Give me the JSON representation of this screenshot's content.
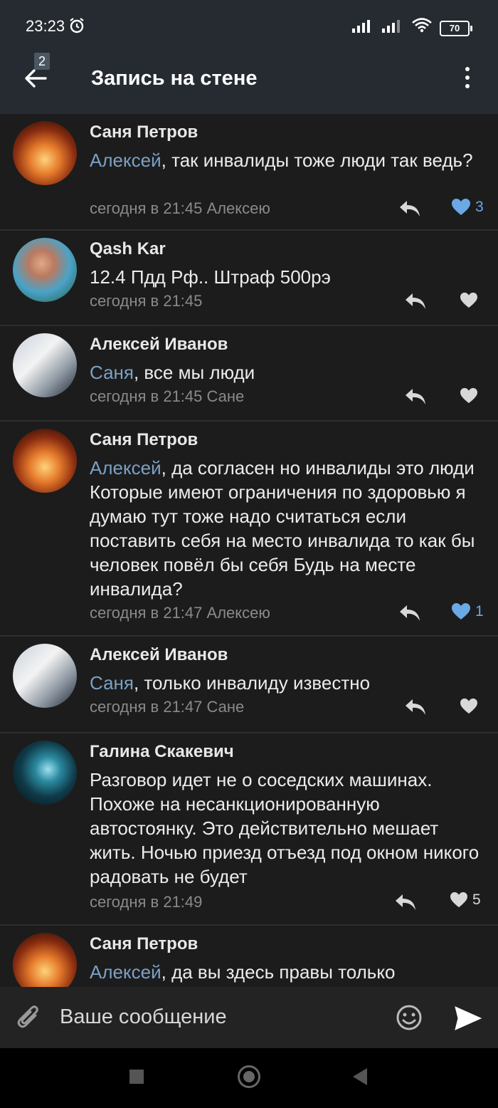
{
  "status": {
    "time": "23:23",
    "battery": "70"
  },
  "appbar": {
    "title": "Запись на стене",
    "badge": "2"
  },
  "comments": [
    {
      "author": "Саня Петров",
      "reply_to": "Алексей",
      "text": ", так инвалиды тоже люди так ведь?",
      "time": "сегодня в 21:45",
      "meta_to": " Алексею",
      "likes": "3"
    },
    {
      "author": "Qash Kar",
      "reply_to": "",
      "text": "12.4 Пдд Рф.. Штраф 500рэ",
      "time": "сегодня в 21:45",
      "meta_to": "",
      "likes": ""
    },
    {
      "author": "Алексей Иванов",
      "reply_to": "Саня",
      "text": ", все мы люди",
      "time": "сегодня в 21:45",
      "meta_to": " Сане",
      "likes": ""
    },
    {
      "author": "Саня Петров",
      "reply_to": "Алексей",
      "text": ", да согласен но инвалиды это люди Которые имеют ограничения по здоровью я думаю тут тоже надо считаться если поставить себя на место инвалида то как бы человек повёл бы себя Будь на месте инвалида?",
      "time": "сегодня в 21:47",
      "meta_to": " Алексею",
      "likes": "1"
    },
    {
      "author": "Алексей Иванов",
      "reply_to": "Саня",
      "text": ", только инвалиду известно",
      "time": "сегодня в 21:47",
      "meta_to": " Сане",
      "likes": ""
    },
    {
      "author": "Галина Скакевич",
      "reply_to": "",
      "text": "Разговор идет не о соседских машинах. Похоже на несанкционированную автостоянку. Это действительно мешает жить.   Ночью приезд отъезд под окном никого радовать не будет",
      "time": "сегодня в 21:49",
      "meta_to": "",
      "likes": "5"
    },
    {
      "author": "Саня Петров",
      "reply_to": "Алексей",
      "text": ", да вы здесь правы только",
      "time": "",
      "meta_to": "",
      "likes": ""
    }
  ],
  "input": {
    "placeholder": "Ваше сообщение"
  },
  "colors": {
    "accent": "#6aa8e6",
    "link": "#7aa1c6",
    "bar": "#252b30",
    "background": "#1c1c1c"
  },
  "icons": [
    "back-arrow-icon",
    "more-vertical-icon",
    "reply-icon",
    "heart-icon",
    "paperclip-icon",
    "emoji-icon",
    "send-icon",
    "alarm-icon",
    "signal-icon",
    "wifi-icon",
    "battery-icon"
  ]
}
